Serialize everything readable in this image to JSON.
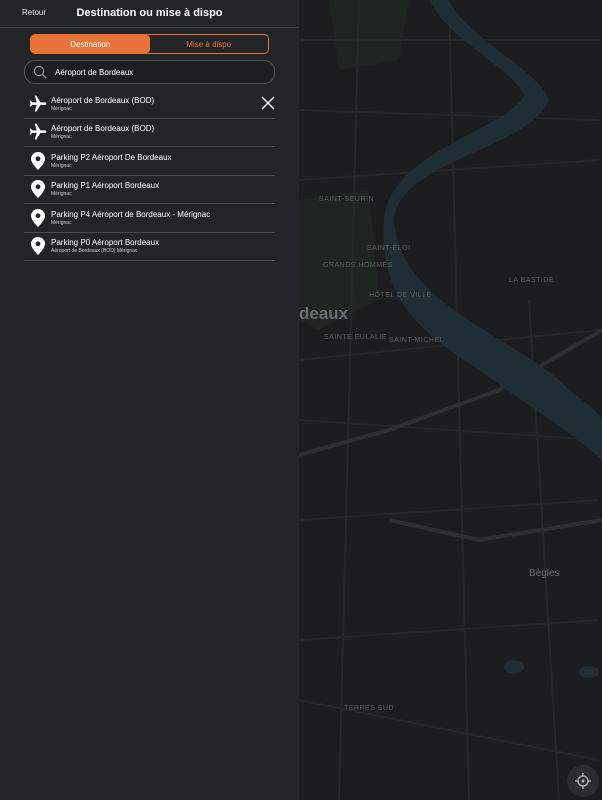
{
  "header": {
    "back_label": "Retour",
    "title": "Destination ou mise à dispo"
  },
  "segments": [
    {
      "label": "Destination",
      "active": true
    },
    {
      "label": "Mise à dispo",
      "active": false
    }
  ],
  "search": {
    "value": "Aéroport de Bordeaux",
    "icon": "search-icon"
  },
  "results": [
    {
      "icon": "airplane-icon",
      "title": "Aéroport de Bordeaux (BOD)",
      "subtitle": "Mérignac"
    },
    {
      "icon": "airplane-icon",
      "title": "Aéroport de Bordeaux (BOD)",
      "subtitle": "Mérignac"
    },
    {
      "icon": "location-pin-icon",
      "title": "Parking P2 Aéroport De Bordeaux",
      "subtitle": "Mérignac"
    },
    {
      "icon": "location-pin-icon",
      "title": "Parking P1 Aéroport Bordeaux",
      "subtitle": "Mérignac"
    },
    {
      "icon": "location-pin-icon",
      "title": "Parking P4 Aéroport de Bordeaux - Mérignac",
      "subtitle": "Mérignac"
    },
    {
      "icon": "location-pin-icon",
      "title": "Parking P0 Aéroport Bordeaux",
      "subtitle": "Aéroport de Bordeaux (BOD) Mérignac"
    }
  ],
  "map": {
    "labels": {
      "city": "deaux",
      "begles": "Bègles",
      "saint_michel": "Saint-Michel",
      "la_bastide": "La Bastide",
      "saint_eloi": "Saint-Éloi",
      "grands_hommes": "Grands Hommes",
      "hotel_de_ville": "Hôtel de Ville",
      "sainte_eulalie": "Sainte Eulalie",
      "saint_seurin": "Saint-Seurin",
      "terres_sud": "Terres Sud"
    },
    "colors": {
      "water": "#1f2d36",
      "park": "#1f2a22",
      "road": "#2a2b2e"
    }
  },
  "locate_button": {
    "icon": "locate-icon"
  },
  "colors": {
    "accent": "#e7733a",
    "panel": "#232427"
  }
}
